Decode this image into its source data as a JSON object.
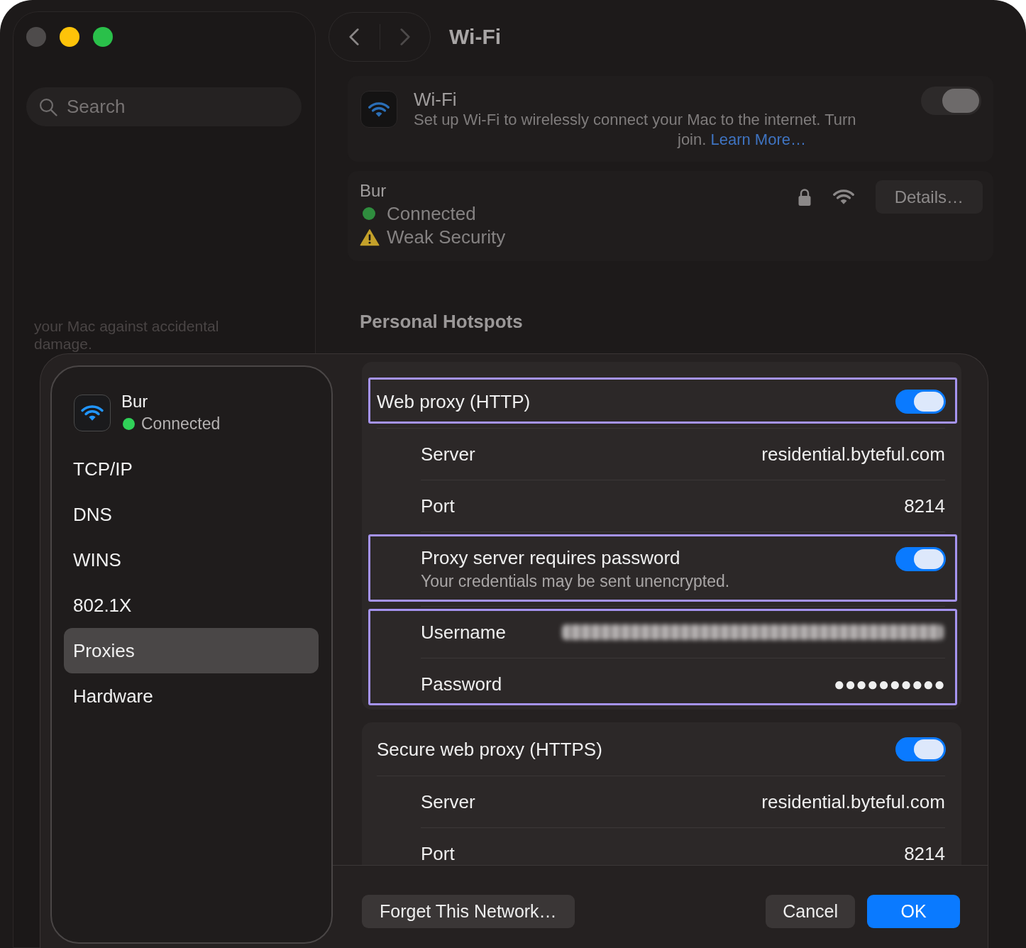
{
  "window": {
    "traffic_lights": [
      {
        "color": "#4e4b4b"
      },
      {
        "color": "#fec309"
      },
      {
        "color": "#2ac04a"
      }
    ],
    "nav": [
      {
        "kind": "back",
        "disabled": false
      },
      {
        "kind": "forward",
        "disabled": true
      }
    ],
    "title": "Wi-Fi"
  },
  "sidebar": {
    "search": {
      "placeholder": "Search"
    },
    "note": "your Mac against accidental damage."
  },
  "wifi": {
    "title": "Wi-Fi",
    "description": "Set up Wi-Fi to wirelessly connect your Mac to the internet. Turn",
    "description_end": "join.",
    "link": "Learn More…",
    "on": true
  },
  "network": {
    "name": "Bur",
    "status": "Connected",
    "warning": "Weak Security",
    "button": "Details…"
  },
  "section": {
    "title": "Personal Hotspots"
  },
  "sheet": {
    "network": {
      "name": "Bur",
      "status": "Connected"
    },
    "nav": [
      {
        "label": "TCP/IP",
        "selected": false
      },
      {
        "label": "DNS",
        "selected": false
      },
      {
        "label": "WINS",
        "selected": false
      },
      {
        "label": "802.1X",
        "selected": false
      },
      {
        "label": "Proxies",
        "selected": true
      },
      {
        "label": "Hardware",
        "selected": false
      }
    ],
    "groups": [
      {
        "blocks": [
          {
            "highlighted": true,
            "rows": [
              {
                "kind": "header",
                "label": "Web proxy (HTTP)",
                "on": true
              }
            ]
          },
          {
            "highlighted": false,
            "rows": [
              {
                "kind": "field",
                "label": "Server",
                "value": "residential.byteful.com"
              },
              {
                "kind": "field",
                "label": "Port",
                "value": "8214"
              }
            ]
          },
          {
            "highlighted": true,
            "rows": [
              {
                "kind": "switch",
                "label": "Proxy server requires password",
                "note": "Your credentials may be sent unencrypted.",
                "on": true
              }
            ]
          },
          {
            "highlighted": true,
            "rows": [
              {
                "kind": "redacted",
                "label": "Username"
              },
              {
                "kind": "field",
                "label": "Password",
                "value": "●●●●●●●●●●"
              }
            ]
          }
        ]
      },
      {
        "blocks": [
          {
            "highlighted": false,
            "rows": [
              {
                "kind": "header",
                "label": "Secure web proxy (HTTPS)",
                "on": true
              },
              {
                "kind": "field",
                "label": "Server",
                "value": "residential.byteful.com"
              },
              {
                "kind": "field",
                "label": "Port",
                "value": "8214"
              }
            ]
          }
        ]
      }
    ],
    "footer": {
      "left": {
        "label": "Forget This Network…"
      },
      "buttons": [
        {
          "label": "Cancel",
          "kind": "cancel"
        },
        {
          "label": "OK",
          "kind": "confirm"
        }
      ]
    }
  }
}
